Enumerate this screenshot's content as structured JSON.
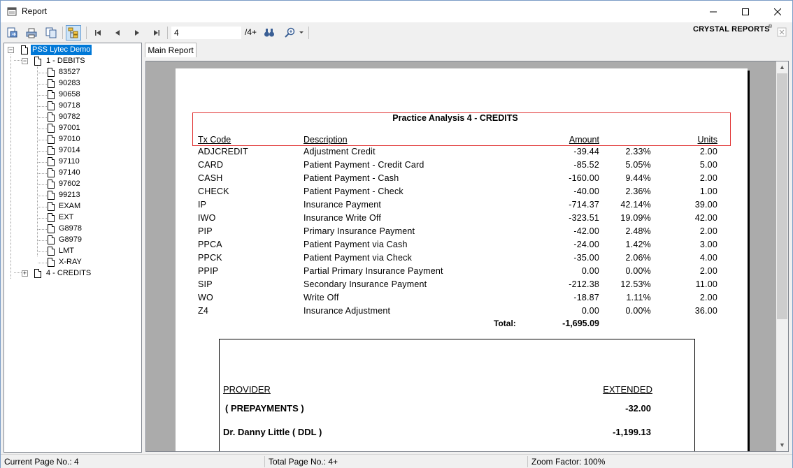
{
  "window": {
    "title": "Report",
    "controls": {
      "minimize": "minimize-icon",
      "maximize": "maximize-icon",
      "close": "close-icon"
    }
  },
  "toolbar": {
    "buttons": [
      "export-icon",
      "print-icon",
      "copy-icon",
      "group-tree-toggle-icon",
      "first-page-icon",
      "previous-page-icon",
      "next-page-icon",
      "last-page-icon",
      "find-icon",
      "zoom-icon"
    ],
    "page_value": "4",
    "page_of": "/4+",
    "brand": "CRYSTAL REPORTS",
    "brand_mark": "®"
  },
  "tree": {
    "root": "PSS Lytec Demo",
    "groups": [
      {
        "label": "1 - DEBITS",
        "expanded": true,
        "children": [
          "83527",
          "90283",
          "90658",
          "90718",
          "90782",
          "97001",
          "97010",
          "97014",
          "97110",
          "97140",
          "97602",
          "99213",
          "EXAM",
          "EXT",
          "G8978",
          "G8979",
          "LMT",
          "X-RAY"
        ]
      },
      {
        "label": "4 - CREDITS",
        "expanded": false,
        "children": []
      }
    ]
  },
  "tabs": {
    "main": "Main Report"
  },
  "report": {
    "title": "Practice Analysis 4 - CREDITS",
    "headers": {
      "code": "Tx Code",
      "description": "Description",
      "amount": "Amount",
      "units": "Units"
    },
    "rows": [
      {
        "code": "ADJCREDIT",
        "description": "Adjustment Credit",
        "amount": "-39.44",
        "percent": "2.33%",
        "units": "2.00"
      },
      {
        "code": "CARD",
        "description": "Patient Payment - Credit Card",
        "amount": "-85.52",
        "percent": "5.05%",
        "units": "5.00"
      },
      {
        "code": "CASH",
        "description": "Patient Payment - Cash",
        "amount": "-160.00",
        "percent": "9.44%",
        "units": "2.00"
      },
      {
        "code": "CHECK",
        "description": "Patient Payment - Check",
        "amount": "-40.00",
        "percent": "2.36%",
        "units": "1.00"
      },
      {
        "code": "IP",
        "description": "Insurance Payment",
        "amount": "-714.37",
        "percent": "42.14%",
        "units": "39.00"
      },
      {
        "code": "IWO",
        "description": "Insurance Write Off",
        "amount": "-323.51",
        "percent": "19.09%",
        "units": "42.00"
      },
      {
        "code": "PIP",
        "description": "Primary Insurance Payment",
        "amount": "-42.00",
        "percent": "2.48%",
        "units": "2.00"
      },
      {
        "code": "PPCA",
        "description": "Patient Payment via Cash",
        "amount": "-24.00",
        "percent": "1.42%",
        "units": "3.00"
      },
      {
        "code": "PPCK",
        "description": "Patient Payment via Check",
        "amount": "-35.00",
        "percent": "2.06%",
        "units": "4.00"
      },
      {
        "code": "PPIP",
        "description": "Partial Primary Insurance Payment",
        "amount": "0.00",
        "percent": "0.00%",
        "units": "2.00"
      },
      {
        "code": "SIP",
        "description": "Secondary Insurance Payment",
        "amount": "-212.38",
        "percent": "12.53%",
        "units": "11.00"
      },
      {
        "code": "WO",
        "description": "Write Off",
        "amount": "-18.87",
        "percent": "1.11%",
        "units": "2.00"
      },
      {
        "code": "Z4",
        "description": "Insurance Adjustment",
        "amount": "0.00",
        "percent": "0.00%",
        "units": "36.00"
      }
    ],
    "total_label": "Total:",
    "total_value": "-1,695.09",
    "subreport": {
      "headers": {
        "provider": "PROVIDER",
        "extended": "EXTENDED"
      },
      "rows": [
        {
          "provider": "( PREPAYMENTS )",
          "extended": "-32.00"
        },
        {
          "provider": "Dr. Danny Little ( DDL )",
          "extended": "-1,199.13"
        }
      ]
    }
  },
  "status": {
    "current_page": "Current Page No.: 4",
    "total_page": "Total Page No.: 4+",
    "zoom": "Zoom Factor: 100%"
  },
  "colors": {
    "selection": "#0078d7",
    "highlight_box": "#e03030",
    "viewer_bg": "#ababab"
  }
}
